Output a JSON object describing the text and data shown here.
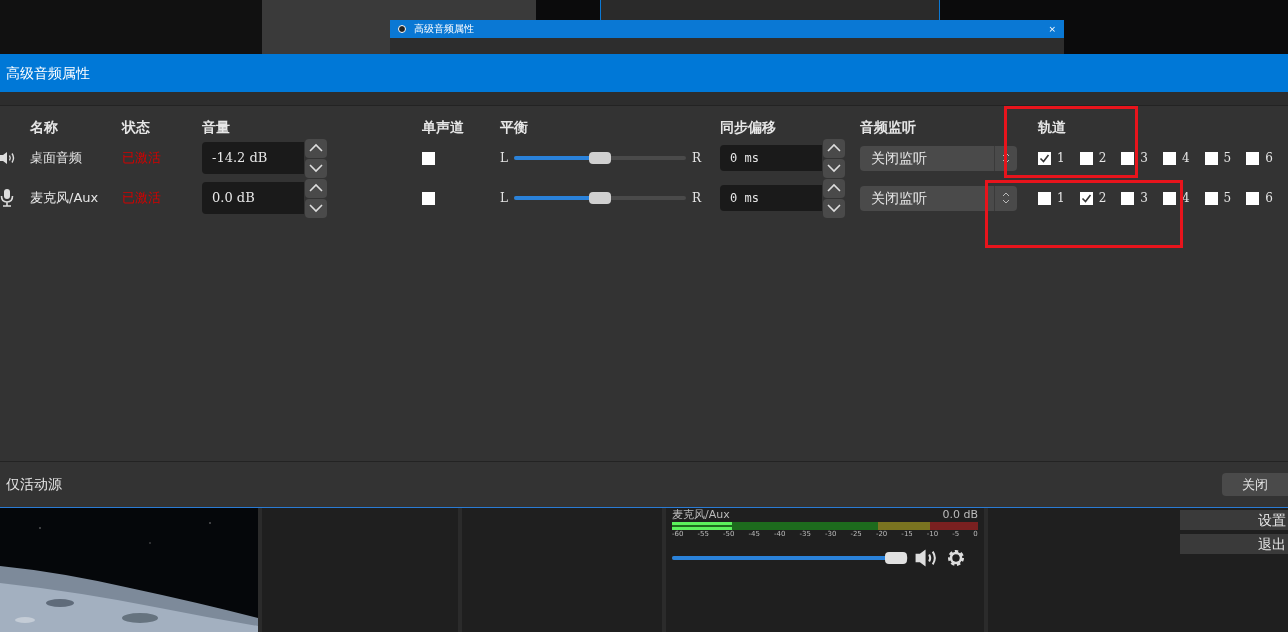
{
  "backdrop_window": {
    "title": "高级音频属性",
    "close": "×"
  },
  "dialog": {
    "title": "高级音频属性",
    "columns": [
      "名称",
      "状态",
      "音量",
      "单声道",
      "平衡",
      "同步偏移",
      "音频监听",
      "轨道"
    ],
    "sources": [
      {
        "kind": "speaker",
        "name": "桌面音频",
        "status": "已激活",
        "volume": "-14.2 dB",
        "mono": false,
        "balance_left": "L",
        "balance_right": "R",
        "level": 0.5,
        "sync": "0 ms",
        "monitoring": "关闭监听",
        "tracks": [
          {
            "label": "1",
            "checked": true
          },
          {
            "label": "2",
            "checked": false
          },
          {
            "label": "3",
            "checked": false
          },
          {
            "label": "4",
            "checked": false
          },
          {
            "label": "5",
            "checked": false
          },
          {
            "label": "6",
            "checked": false
          }
        ]
      },
      {
        "kind": "microphone",
        "name": "麦克风/Aux",
        "status": "已激活",
        "volume": "0.0 dB",
        "mono": false,
        "balance_left": "L",
        "balance_right": "R",
        "level": 0.5,
        "sync": "0 ms",
        "monitoring": "关闭监听",
        "tracks": [
          {
            "label": "1",
            "checked": false
          },
          {
            "label": "2",
            "checked": true
          },
          {
            "label": "3",
            "checked": false
          },
          {
            "label": "4",
            "checked": false
          },
          {
            "label": "5",
            "checked": false
          },
          {
            "label": "6",
            "checked": false
          }
        ]
      }
    ],
    "footer": {
      "active_only": "仅活动源",
      "close_button": "关闭"
    }
  },
  "mixer": {
    "source": "麦克风/Aux",
    "reading": "0.0 dB",
    "ticks": [
      "-60",
      "-55",
      "-50",
      "-45",
      "-40",
      "-35",
      "-30",
      "-25",
      "-20",
      "-15",
      "-10",
      "-5",
      "0"
    ],
    "level": 0.95
  },
  "controls": [
    "设置",
    "退出"
  ]
}
